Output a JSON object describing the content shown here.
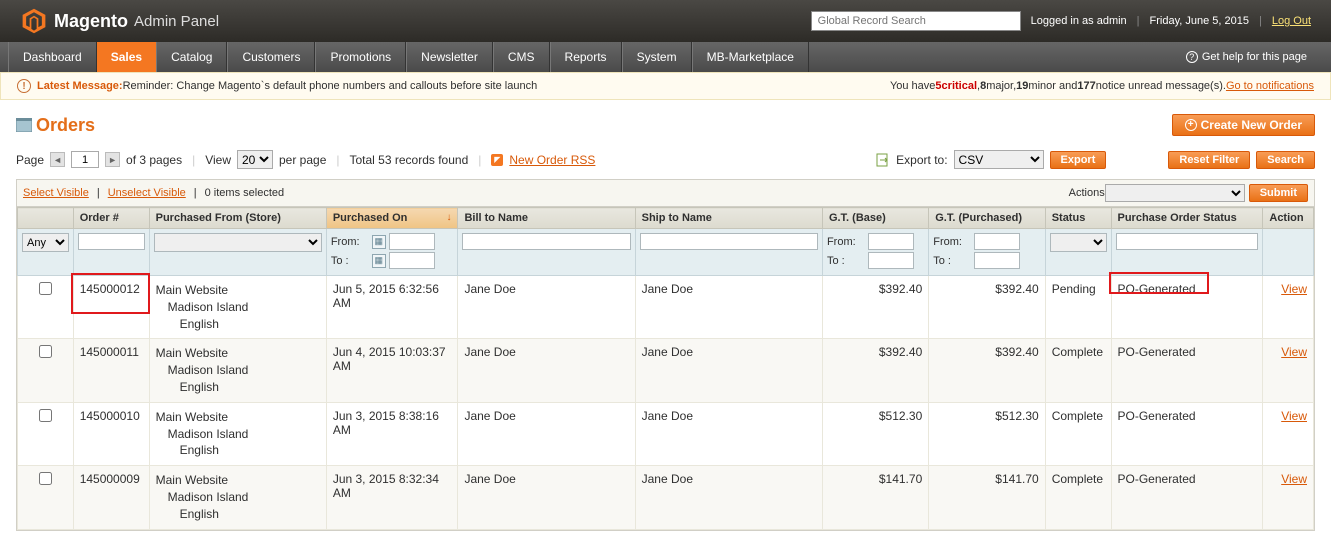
{
  "header": {
    "brand": "Magento",
    "panel": "Admin Panel",
    "search_placeholder": "Global Record Search",
    "logged_in": "Logged in as admin",
    "date": "Friday, June 5, 2015",
    "logout": "Log Out"
  },
  "nav": {
    "items": [
      "Dashboard",
      "Sales",
      "Catalog",
      "Customers",
      "Promotions",
      "Newsletter",
      "CMS",
      "Reports",
      "System",
      "MB-Marketplace"
    ],
    "active_index": 1,
    "help": "Get help for this page"
  },
  "message": {
    "latest_label": "Latest Message:",
    "latest_text": " Reminder: Change Magento`s default phone numbers and callouts before site launch",
    "you_have": "You have ",
    "critical_n": "5",
    "critical_t": " critical",
    "major_n": "8",
    "major_t": " major, ",
    "minor_n": "19",
    "minor_t": " minor and ",
    "notice_n": "177",
    "notice_t": " notice unread message(s). ",
    "go": "Go to notifications",
    "comma": ", "
  },
  "page": {
    "title": "Orders",
    "create_btn": "Create New Order"
  },
  "pager": {
    "page_label": "Page",
    "page": "1",
    "of": "of 3 pages",
    "view": "View",
    "perpage": "20",
    "pp_label": "per page",
    "total": "Total 53 records found",
    "rss": "New Order RSS",
    "export_label": "Export to:",
    "export_fmt": "CSV",
    "export_btn": "Export",
    "reset": "Reset Filter",
    "search": "Search"
  },
  "gridtop": {
    "select_visible": "Select Visible",
    "unselect_visible": "Unselect Visible",
    "items_sel": "0 items selected",
    "actions": "Actions",
    "submit": "Submit"
  },
  "columns": [
    "",
    "Order #",
    "Purchased From (Store)",
    "Purchased On",
    "Bill to Name",
    "Ship to Name",
    "G.T. (Base)",
    "G.T. (Purchased)",
    "Status",
    "Purchase Order Status",
    "Action"
  ],
  "filters": {
    "any": "Any",
    "from": "From:",
    "to": "To :"
  },
  "rows": [
    {
      "order": "145000012",
      "store": [
        "Main Website",
        "Madison Island",
        "English"
      ],
      "purchased_on": "Jun 5, 2015 6:32:56 AM",
      "bill": "Jane Doe",
      "ship": "Jane Doe",
      "gt_base": "$392.40",
      "gt_purch": "$392.40",
      "status": "Pending",
      "po": "PO-Generated",
      "action": "View",
      "hl_order": true,
      "hl_po": true
    },
    {
      "order": "145000011",
      "store": [
        "Main Website",
        "Madison Island",
        "English"
      ],
      "purchased_on": "Jun 4, 2015 10:03:37 AM",
      "bill": "Jane Doe",
      "ship": "Jane Doe",
      "gt_base": "$392.40",
      "gt_purch": "$392.40",
      "status": "Complete",
      "po": "PO-Generated",
      "action": "View"
    },
    {
      "order": "145000010",
      "store": [
        "Main Website",
        "Madison Island",
        "English"
      ],
      "purchased_on": "Jun 3, 2015 8:38:16 AM",
      "bill": "Jane Doe",
      "ship": "Jane Doe",
      "gt_base": "$512.30",
      "gt_purch": "$512.30",
      "status": "Complete",
      "po": "PO-Generated",
      "action": "View"
    },
    {
      "order": "145000009",
      "store": [
        "Main Website",
        "Madison Island",
        "English"
      ],
      "purchased_on": "Jun 3, 2015 8:32:34 AM",
      "bill": "Jane Doe",
      "ship": "Jane Doe",
      "gt_base": "$141.70",
      "gt_purch": "$141.70",
      "status": "Complete",
      "po": "PO-Generated",
      "action": "View"
    }
  ]
}
